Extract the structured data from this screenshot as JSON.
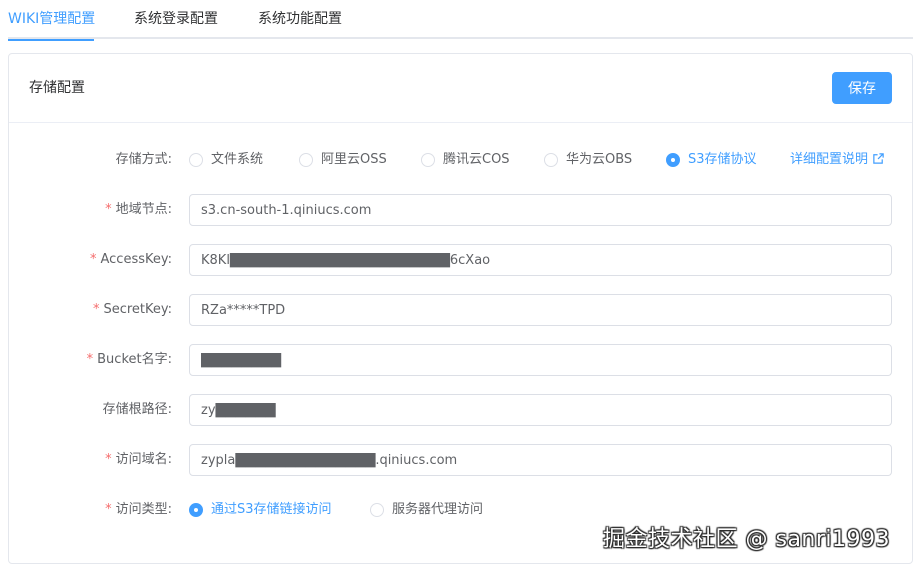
{
  "tabs": [
    {
      "label": "WIKI管理配置",
      "active": true
    },
    {
      "label": "系统登录配置",
      "active": false
    },
    {
      "label": "系统功能配置",
      "active": false
    }
  ],
  "card": {
    "title": "存储配置",
    "save_label": "保存"
  },
  "form": {
    "storage_type": {
      "label": "存储方式:",
      "options": [
        "文件系统",
        "阿里云OSS",
        "腾讯云COS",
        "华为云OBS",
        "S3存储协议"
      ],
      "selected": "S3存储协议",
      "doc_link": "详细配置说明"
    },
    "region": {
      "label": "地域节点:",
      "required": true,
      "value": "s3.cn-south-1.qiniucs.com"
    },
    "access_key": {
      "label": "AccessKey:",
      "required": true,
      "value": "K8Kl██████████████████████6cXao"
    },
    "secret_key": {
      "label": "SecretKey:",
      "required": true,
      "value": "RZa*****TPD"
    },
    "bucket": {
      "label": "Bucket名字:",
      "required": true,
      "value": "████████"
    },
    "root_path": {
      "label": "存储根路径:",
      "required": false,
      "value": "zy██████"
    },
    "domain": {
      "label": "访问域名:",
      "required": true,
      "value": "zypla██████████████.qiniucs.com"
    },
    "access_type": {
      "label": "访问类型:",
      "required": true,
      "options": [
        "通过S3存储链接访问",
        "服务器代理访问"
      ],
      "selected": "通过S3存储链接访问"
    }
  },
  "watermark": "掘金技术社区 @ sanri1993",
  "colors": {
    "accent": "#409eff",
    "required": "#f56c6c",
    "border": "#dcdfe6"
  }
}
